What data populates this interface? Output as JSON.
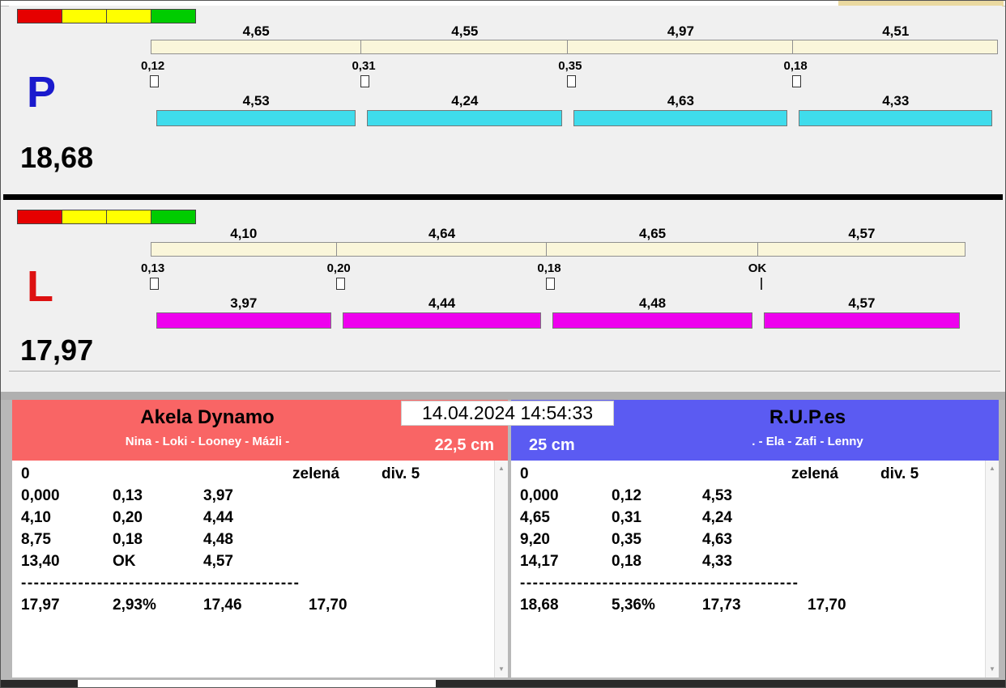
{
  "timestamp": "14.04.2024 14:54:33",
  "icons": {
    "scroll_up_icon": "▲",
    "scroll_down_icon": "▼"
  },
  "colors": {
    "lane_p_letter": "#1a1acd",
    "lane_l_letter": "#dd1111",
    "cyan_bar": "#3fdcec",
    "magenta_bar": "#ee00ee",
    "segment_bar": "#faf6da",
    "traffic_strip": [
      "#e60000",
      "#ffff00",
      "#ffff00",
      "#00cc00"
    ],
    "team_left_header": "#f96565",
    "team_right_header": "#5b5bf2"
  },
  "lane_p": {
    "label": "P",
    "total": "18,68",
    "top_segments": [
      "4,65",
      "4,55",
      "4,97",
      "4,51"
    ],
    "splits": [
      "0,12",
      "0,31",
      "0,35",
      "0,18"
    ],
    "bottom_segments": [
      "4,53",
      "4,24",
      "4,63",
      "4,33"
    ]
  },
  "lane_l": {
    "label": "L",
    "total": "17,97",
    "top_segments": [
      "4,10",
      "4,64",
      "4,65",
      "4,57"
    ],
    "splits": [
      "0,13",
      "0,20",
      "0,18",
      "OK"
    ],
    "bottom_segments": [
      "3,97",
      "4,44",
      "4,48",
      "4,57"
    ]
  },
  "team_left": {
    "name": "Akela Dynamo",
    "dogs": "Nina - Loki - Looney - Mázli -",
    "height": "22,5 cm",
    "run": "0",
    "light": "zelená",
    "division": "div. 5",
    "rows": [
      [
        "0,000",
        "0,13",
        "3,97"
      ],
      [
        "4,10",
        "0,20",
        "4,44"
      ],
      [
        "8,75",
        "0,18",
        "4,48"
      ],
      [
        "13,40",
        "OK",
        "4,57"
      ]
    ],
    "separator": "--------------------------------------------",
    "totals": [
      "17,97",
      "2,93%",
      "17,46",
      "17,70"
    ]
  },
  "team_right": {
    "name": "R.U.P.es",
    "dogs": ". - Ela - Zafi - Lenny",
    "height": "25 cm",
    "run": "0",
    "light": "zelená",
    "division": "div. 5",
    "rows": [
      [
        "0,000",
        "0,12",
        "4,53"
      ],
      [
        "4,65",
        "0,31",
        "4,24"
      ],
      [
        "9,20",
        "0,35",
        "4,63"
      ],
      [
        "14,17",
        "0,18",
        "4,33"
      ]
    ],
    "separator": "--------------------------------------------",
    "totals": [
      "18,68",
      "5,36%",
      "17,73",
      "17,70"
    ]
  }
}
